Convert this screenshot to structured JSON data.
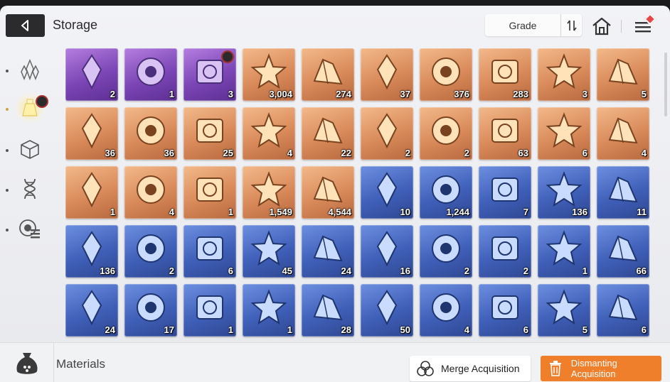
{
  "header": {
    "title": "Storage",
    "sort_label": "Grade",
    "back_icon": "back-arrow-icon",
    "sort_icon": "sort-toggle-icon",
    "home_icon": "home-icon",
    "menu_icon": "menu-icon"
  },
  "sidebar": {
    "items": [
      {
        "icon": "crystal-icon",
        "active": false
      },
      {
        "icon": "potion-icon",
        "active": true,
        "has_alert": true
      },
      {
        "icon": "cube-icon",
        "active": false
      },
      {
        "icon": "dna-icon",
        "active": false
      },
      {
        "icon": "module-icon",
        "active": false
      }
    ]
  },
  "items": [
    {
      "name": "card-chip",
      "rarity": "purple",
      "qty": "2"
    },
    {
      "name": "stone-face",
      "rarity": "purple",
      "qty": "1"
    },
    {
      "name": "gold-prism",
      "rarity": "purple",
      "qty": "3",
      "alert": true
    },
    {
      "name": "blue-core",
      "rarity": "orange",
      "qty": "3,004"
    },
    {
      "name": "cyan-orb",
      "rarity": "orange",
      "qty": "274"
    },
    {
      "name": "chip-plate",
      "rarity": "orange",
      "qty": "37"
    },
    {
      "name": "gold-ticket",
      "rarity": "orange",
      "qty": "376"
    },
    {
      "name": "gold-ticket-star",
      "rarity": "orange",
      "qty": "283"
    },
    {
      "name": "violet-eye",
      "rarity": "orange",
      "qty": "3"
    },
    {
      "name": "gold-feather",
      "rarity": "orange",
      "qty": "5"
    },
    {
      "name": "rainbow-crystal",
      "rarity": "orange",
      "qty": "36"
    },
    {
      "name": "prism-crystal",
      "rarity": "orange",
      "qty": "36"
    },
    {
      "name": "gold-disc-book",
      "rarity": "orange",
      "qty": "25"
    },
    {
      "name": "purple-book",
      "rarity": "orange",
      "qty": "4"
    },
    {
      "name": "gold-medal-1",
      "rarity": "orange",
      "qty": "22"
    },
    {
      "name": "gold-medal-2",
      "rarity": "orange",
      "qty": "2"
    },
    {
      "name": "gold-medal-3",
      "rarity": "orange",
      "qty": "2"
    },
    {
      "name": "gold-shards",
      "rarity": "orange",
      "qty": "63"
    },
    {
      "name": "spray-gun",
      "rarity": "orange",
      "qty": "6"
    },
    {
      "name": "paper-stack",
      "rarity": "orange",
      "qty": "4"
    },
    {
      "name": "dreamcatcher",
      "rarity": "orange",
      "qty": "1"
    },
    {
      "name": "brown-tome",
      "rarity": "orange",
      "qty": "4"
    },
    {
      "name": "guitar-pick",
      "rarity": "orange",
      "qty": "1"
    },
    {
      "name": "music-scroll",
      "rarity": "orange",
      "qty": "1,549"
    },
    {
      "name": "black-urchin",
      "rarity": "orange",
      "qty": "4,544"
    },
    {
      "name": "blue-id-card",
      "rarity": "blue",
      "qty": "10"
    },
    {
      "name": "blue-ticket",
      "rarity": "blue",
      "qty": "1,244"
    },
    {
      "name": "red-crystal",
      "rarity": "blue",
      "qty": "7"
    },
    {
      "name": "amber-crystal",
      "rarity": "blue",
      "qty": "136"
    },
    {
      "name": "violet-crystal",
      "rarity": "blue",
      "qty": "11"
    },
    {
      "name": "green-crystal",
      "rarity": "blue",
      "qty": "136"
    },
    {
      "name": "cyan-crystal",
      "rarity": "blue",
      "qty": "2"
    },
    {
      "name": "blue-book-1",
      "rarity": "blue",
      "qty": "6"
    },
    {
      "name": "blue-book-2",
      "rarity": "blue",
      "qty": "45"
    },
    {
      "name": "blue-book-3",
      "rarity": "blue",
      "qty": "24"
    },
    {
      "name": "blue-book-4",
      "rarity": "blue",
      "qty": "16"
    },
    {
      "name": "blue-book-5",
      "rarity": "blue",
      "qty": "2"
    },
    {
      "name": "blue-book-6",
      "rarity": "blue",
      "qty": "2"
    },
    {
      "name": "silver-medal-1",
      "rarity": "blue",
      "qty": "1"
    },
    {
      "name": "silver-medal-2",
      "rarity": "blue",
      "qty": "66"
    },
    {
      "name": "silver-medal-3",
      "rarity": "blue",
      "qty": "24"
    },
    {
      "name": "silver-medal-4",
      "rarity": "blue",
      "qty": "17"
    },
    {
      "name": "silver-medal-5",
      "rarity": "blue",
      "qty": "1"
    },
    {
      "name": "silver-medal-6",
      "rarity": "blue",
      "qty": "1"
    },
    {
      "name": "ice-gem",
      "rarity": "blue",
      "qty": "28"
    },
    {
      "name": "strawberry-cake",
      "rarity": "blue",
      "qty": "50"
    },
    {
      "name": "pocket-watch",
      "rarity": "blue",
      "qty": "4"
    },
    {
      "name": "red-medal",
      "rarity": "blue",
      "qty": "6"
    },
    {
      "name": "parchment",
      "rarity": "blue",
      "qty": "5"
    },
    {
      "name": "dark-claw",
      "rarity": "blue",
      "qty": "6"
    }
  ],
  "footer": {
    "category_label": "Materials",
    "category_icon": "material-bag-icon",
    "merge_label": "Merge Acquisition",
    "merge_icon": "merge-circles-icon",
    "dismantle_label": "Dismanting Acquisition",
    "dismantle_icon": "trash-icon"
  },
  "colors": {
    "accent_orange": "#f07f2c",
    "rarity_purple": "#7b45b5",
    "rarity_orange": "#d98a5a",
    "rarity_blue": "#3f5fb8",
    "alert_red": "#e94545"
  }
}
